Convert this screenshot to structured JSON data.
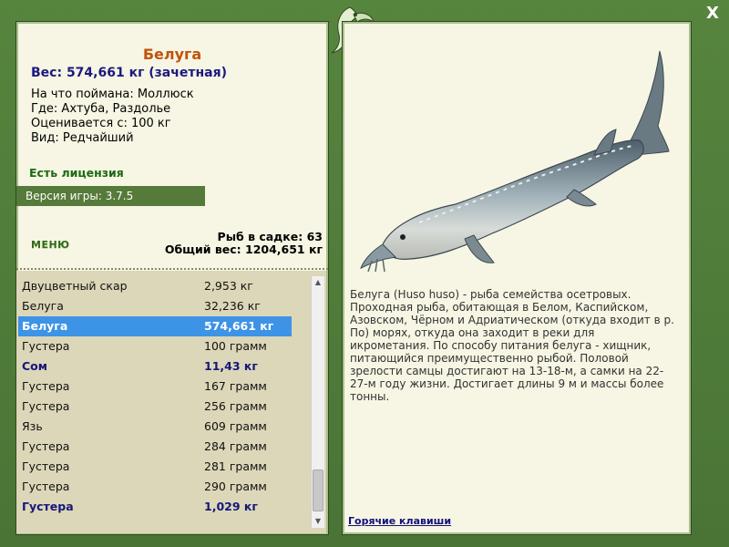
{
  "window": {
    "close_label": "X"
  },
  "fish": {
    "title": "Белуга",
    "weight_line": "Вес: 574,661 кг (зачетная)",
    "caught_on": "На что поймана: Моллюск",
    "location": "Где: Ахтуба, Раздолье",
    "valued_from": "Оценивается с: 100 кг",
    "rarity": "Вид: Редчайший",
    "license": "Есть лицензия",
    "version": "Версия игры: 3.7.5"
  },
  "menu_label": "МЕНЮ",
  "cage": {
    "count": "Рыб в садке: 63",
    "total": "Общий вес: 1204,651 кг"
  },
  "catch_list": [
    {
      "name": "Двуцветный скар",
      "weight": "2,953 кг",
      "state": "normal"
    },
    {
      "name": "Белуга",
      "weight": "32,236 кг",
      "state": "normal"
    },
    {
      "name": "Белуга",
      "weight": "574,661 кг",
      "state": "selected"
    },
    {
      "name": "Густера",
      "weight": "100 грамм",
      "state": "normal"
    },
    {
      "name": "Сом",
      "weight": "11,43 кг",
      "state": "bold"
    },
    {
      "name": "Густера",
      "weight": "167 грамм",
      "state": "normal"
    },
    {
      "name": "Густера",
      "weight": "256 грамм",
      "state": "normal"
    },
    {
      "name": "Язь",
      "weight": "609 грамм",
      "state": "normal"
    },
    {
      "name": "Густера",
      "weight": "284 грамм",
      "state": "normal"
    },
    {
      "name": "Густера",
      "weight": "281 грамм",
      "state": "normal"
    },
    {
      "name": "Густера",
      "weight": "290 грамм",
      "state": "normal"
    },
    {
      "name": "Густера",
      "weight": "1,029 кг",
      "state": "bold"
    }
  ],
  "description": "Белуга (Huso huso) - рыба семейства осетровых. Проходная рыба, обитающая в Белом, Каспийском, Азовском, Чёрном и Адриатическом (откуда входит в р. По) морях, откуда она заходит в реки для икрометания. По способу питания белуга - хищник, питающийся преимущественно рыбой. Половой зрелости самцы достигают на 13-18-м, а самки на 22-27-м году жизни. Достигает длины 9 м и массы более тонны.",
  "hotkeys_label": "Горячие клавиши",
  "icons": {
    "logo": "fish-logo-icon",
    "scroll_up": "arrow-up-icon",
    "scroll_down": "arrow-down-icon"
  },
  "colors": {
    "title": "#c0540a",
    "weight": "#1a1a80",
    "license": "#1b6a12",
    "selected_row": "#3d93e6",
    "frame": "#4f7a3a"
  }
}
